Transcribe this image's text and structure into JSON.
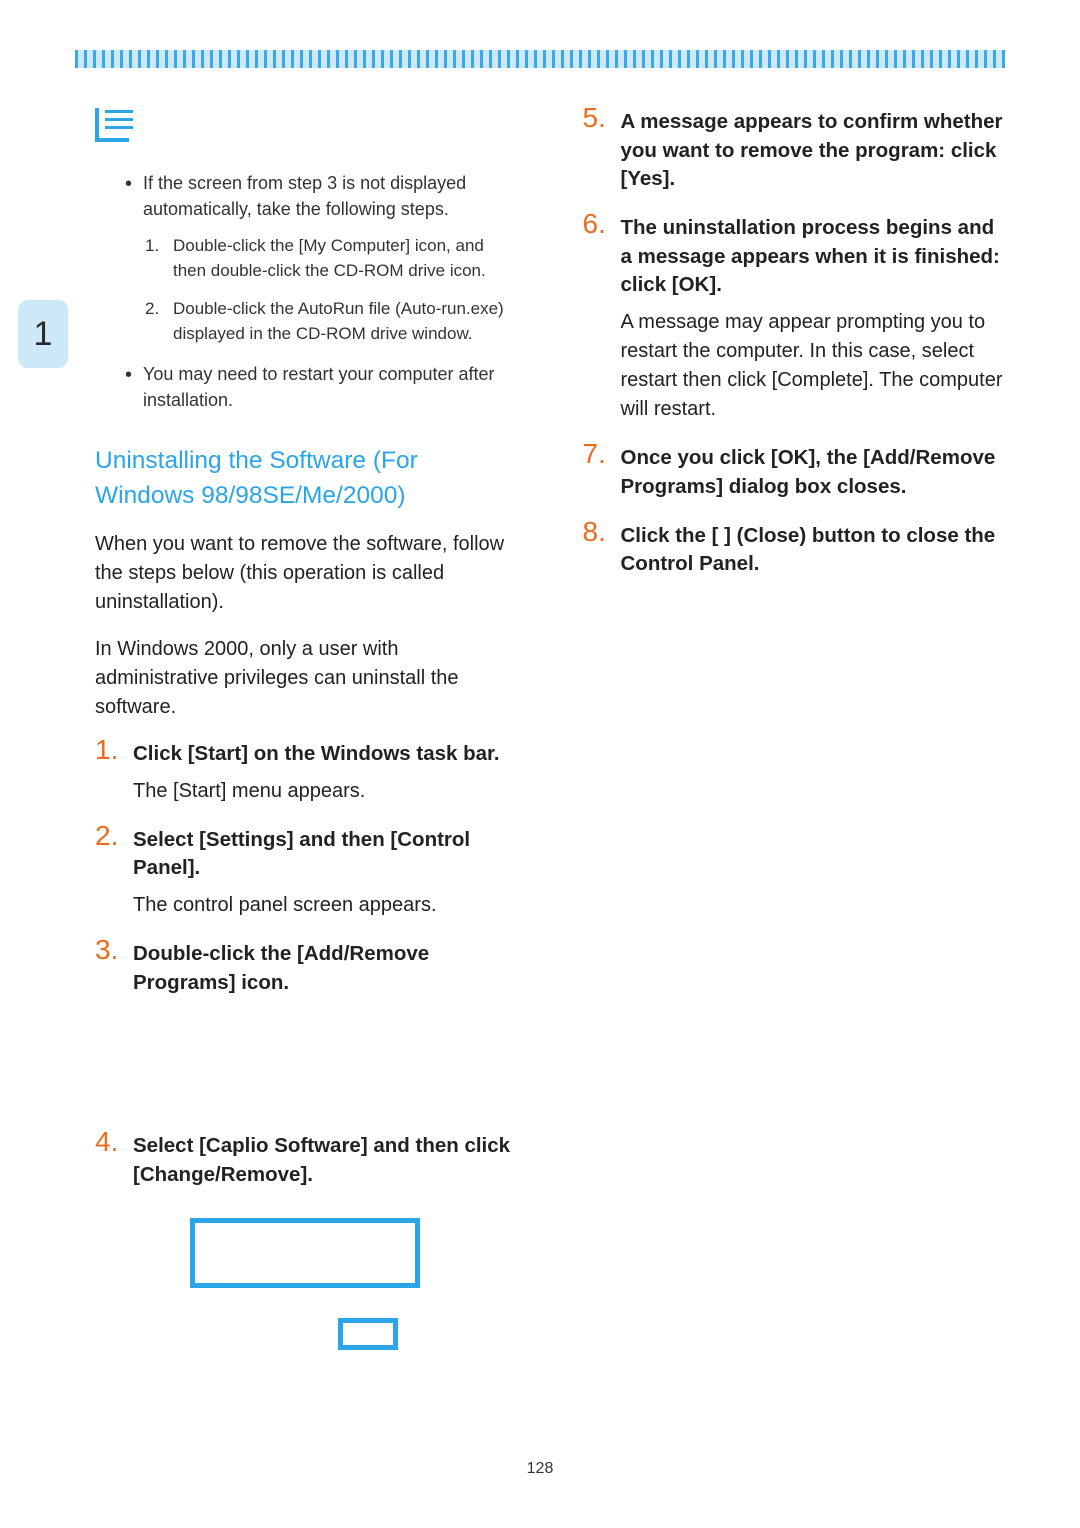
{
  "page_number": "128",
  "sidebar_tab": "1",
  "note": {
    "bullet1": "If the screen from step 3 is not displayed automatically, take the following steps.",
    "sub1_num": "1.",
    "sub1": "Double-click the [My Computer] icon, and then double-click the CD-ROM drive icon.",
    "sub2_num": "2.",
    "sub2": "Double-click the AutoRun file (Auto-run.exe)  displayed in the CD-ROM drive window.",
    "bullet2": "You may need to restart your computer after installation."
  },
  "section": {
    "heading": "Uninstalling the Software (For Windows 98/98SE/Me/2000)",
    "intro1": "When you want to remove the software, follow the steps below (this operation is called uninstallation).",
    "intro2": "In Windows 2000, only a user with administrative privileges can uninstall the software."
  },
  "steps": [
    {
      "num": "1.",
      "title": "Click [Start] on the Windows task bar.",
      "body": "The [Start] menu appears."
    },
    {
      "num": "2.",
      "title": "Select [Settings] and then [Control Panel].",
      "body": "The control panel screen appears."
    },
    {
      "num": "3.",
      "title": "Double-click the [Add/Remove Programs] icon.",
      "body": ""
    },
    {
      "num": "4.",
      "title": "Select [Caplio Software] and then click [Change/Remove].",
      "body": ""
    },
    {
      "num": "5.",
      "title": "A message appears to confirm whether you want to remove the program: click [Yes].",
      "body": ""
    },
    {
      "num": "6.",
      "title": "The uninstallation process begins and a message appears when it is finished: click [OK].",
      "body": "A message may appear prompting you to restart the computer. In this case, select restart then click [Complete]. The computer will restart."
    },
    {
      "num": "7.",
      "title": "Once you click [OK], the [Add/Remove Programs] dialog box closes.",
      "body": ""
    },
    {
      "num": "8.",
      "title": "Click the [  ] (Close) button to close the Control Panel.",
      "body": ""
    }
  ]
}
